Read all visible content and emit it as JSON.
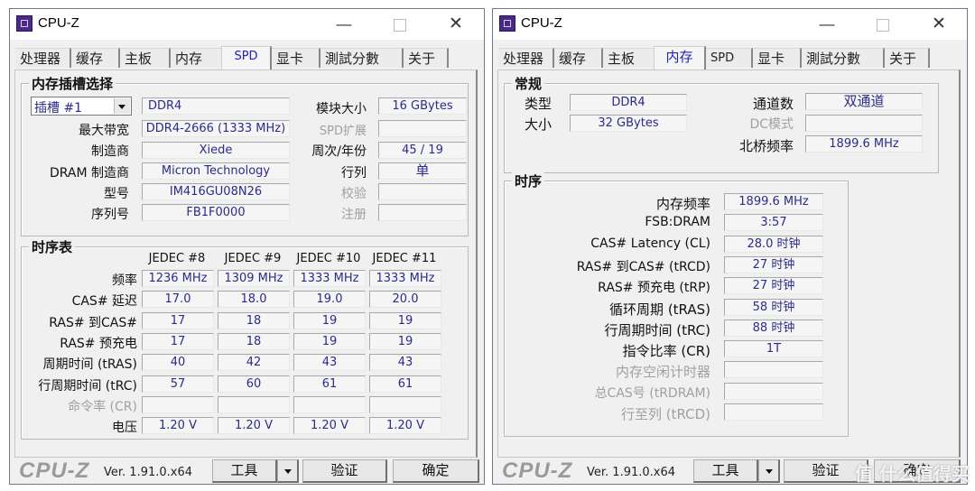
{
  "left_window": {
    "title": "CPU-Z",
    "controls": {
      "minimize": "—",
      "close": "✕"
    },
    "tabs": [
      {
        "label": "处理器",
        "active": false
      },
      {
        "label": "缓存",
        "active": false
      },
      {
        "label": "主板",
        "active": false
      },
      {
        "label": "内存",
        "active": false
      },
      {
        "label": "SPD",
        "active": true
      },
      {
        "label": "显卡",
        "active": false
      },
      {
        "label": "測試分數",
        "active": false
      },
      {
        "label": "关于",
        "active": false
      }
    ],
    "slot_group": {
      "title": "内存插槽选择",
      "slot_select": "插槽 #1",
      "memory_type": "DDR4",
      "max_bandwidth_label": "最大带宽",
      "max_bandwidth": "DDR4-2666 (1333 MHz)",
      "manufacturer_label": "制造商",
      "manufacturer": "Xiede",
      "dram_manufacturer_label": "DRAM 制造商",
      "dram_manufacturer": "Micron Technology",
      "part_number_label": "型号",
      "part_number": "IM416GU08N26",
      "serial_label": "序列号",
      "serial": "FB1F0000",
      "module_size_label": "模块大小",
      "module_size": "16 GBytes",
      "spd_ext_label": "SPD扩展",
      "spd_ext": "",
      "week_year_label": "周次/年份",
      "week_year": "45 / 19",
      "ranks_label": "行列",
      "ranks": "单",
      "correction_label": "校验",
      "correction": "",
      "registered_label": "注册",
      "registered": ""
    },
    "timing_table": {
      "title": "时序表",
      "columns": [
        "JEDEC #8",
        "JEDEC #9",
        "JEDEC #10",
        "JEDEC #11"
      ],
      "rows": [
        {
          "label": "频率",
          "dim": false,
          "values": [
            "1236 MHz",
            "1309 MHz",
            "1333 MHz",
            "1333 MHz"
          ]
        },
        {
          "label": "CAS# 延迟",
          "dim": false,
          "values": [
            "17.0",
            "18.0",
            "19.0",
            "20.0"
          ]
        },
        {
          "label": "RAS# 到CAS#",
          "dim": false,
          "values": [
            "17",
            "18",
            "19",
            "19"
          ]
        },
        {
          "label": "RAS# 预充电",
          "dim": false,
          "values": [
            "17",
            "18",
            "19",
            "19"
          ]
        },
        {
          "label": "周期时间 (tRAS)",
          "dim": false,
          "values": [
            "40",
            "42",
            "43",
            "43"
          ]
        },
        {
          "label": "行周期时间 (tRC)",
          "dim": false,
          "values": [
            "57",
            "60",
            "61",
            "61"
          ]
        },
        {
          "label": "命令率 (CR)",
          "dim": true,
          "values": [
            "",
            "",
            "",
            ""
          ]
        },
        {
          "label": "电压",
          "dim": false,
          "values": [
            "1.20 V",
            "1.20 V",
            "1.20 V",
            "1.20 V"
          ]
        }
      ]
    },
    "footer": {
      "brand": "CPU-Z",
      "version": "Ver. 1.91.0.x64",
      "tools_label": "工具",
      "validate_label": "验证",
      "ok_label": "确定"
    }
  },
  "right_window": {
    "title": "CPU-Z",
    "controls": {
      "minimize": "—",
      "close": "✕"
    },
    "tabs": [
      {
        "label": "处理器",
        "active": false
      },
      {
        "label": "缓存",
        "active": false
      },
      {
        "label": "主板",
        "active": false
      },
      {
        "label": "内存",
        "active": true
      },
      {
        "label": "SPD",
        "active": false
      },
      {
        "label": "显卡",
        "active": false
      },
      {
        "label": "測試分數",
        "active": false
      },
      {
        "label": "关于",
        "active": false
      }
    ],
    "general": {
      "title": "常规",
      "type_label": "类型",
      "type": "DDR4",
      "size_label": "大小",
      "size": "32 GBytes",
      "channels_label": "通道数",
      "channels": "双通道",
      "dc_mode_label": "DC模式",
      "dc_mode": "",
      "nb_freq_label": "北桥频率",
      "nb_freq": "1899.6 MHz"
    },
    "timings": {
      "title": "时序",
      "rows": [
        {
          "label": "内存频率",
          "dim": false,
          "value": "1899.6 MHz"
        },
        {
          "label": "FSB:DRAM",
          "dim": false,
          "value": "3:57"
        },
        {
          "label": "CAS# Latency (CL)",
          "dim": false,
          "value": "28.0 时钟"
        },
        {
          "label": "RAS# 到CAS#  (tRCD)",
          "dim": false,
          "value": "27 时钟"
        },
        {
          "label": "RAS# 预充电 (tRP)",
          "dim": false,
          "value": "27 时钟"
        },
        {
          "label": "循环周期 (tRAS)",
          "dim": false,
          "value": "58 时钟"
        },
        {
          "label": "行周期时间 (tRC)",
          "dim": false,
          "value": "88 时钟"
        },
        {
          "label": "指令比率 (CR)",
          "dim": false,
          "value": "1T"
        },
        {
          "label": "内存空闲计时器",
          "dim": true,
          "value": ""
        },
        {
          "label": "总CAS号 (tRDRAM)",
          "dim": true,
          "value": ""
        },
        {
          "label": "行至列 (tRCD)",
          "dim": true,
          "value": ""
        }
      ]
    },
    "footer": {
      "brand": "CPU-Z",
      "version": "Ver. 1.91.0.x64",
      "tools_label": "工具",
      "validate_label": "验证",
      "ok_label": "确定"
    }
  },
  "watermark": "值 什么值得买"
}
